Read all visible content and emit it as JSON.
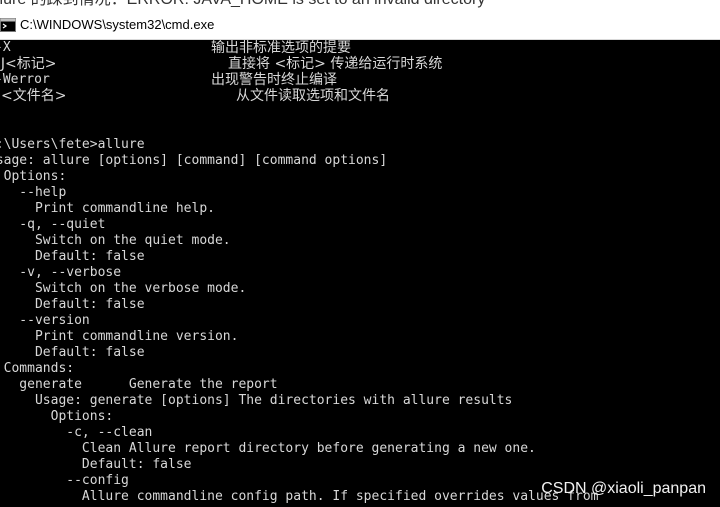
{
  "top_text": "llure 的踩到情况：ERROR: JAVA_HOME is set to an invalid directory",
  "window": {
    "title": "C:\\WINDOWS\\system32\\cmd.exe",
    "icon": "cmd-icon"
  },
  "console": {
    "options_help": [
      {
        "flag": "-X",
        "desc": "输出非标准选项的提要"
      },
      {
        "flag": "-J<标记>",
        "desc": "直接将 <标记> 传递给运行时系统"
      },
      {
        "flag": "-Werror",
        "desc": "出现警告时终止编译"
      },
      {
        "flag": "@<文件名>",
        "desc": "从文件读取选项和文件名"
      }
    ],
    "lines": [
      "C:\\Users\\fete>allure",
      "Usage: allure [options] [command] [command options]",
      "  Options:",
      "    --help",
      "      Print commandline help.",
      "    -q, --quiet",
      "      Switch on the quiet mode.",
      "      Default: false",
      "    -v, --verbose",
      "      Switch on the verbose mode.",
      "      Default: false",
      "    --version",
      "      Print commandline version.",
      "      Default: false",
      "  Commands:",
      "    generate      Generate the report",
      "      Usage: generate [options] The directories with allure results",
      "        Options:",
      "          -c, --clean",
      "            Clean Allure report directory before generating a new one.",
      "            Default: false",
      "          --config",
      "            Allure commandline config path. If specified overrides values from"
    ]
  },
  "watermark": "CSDN @xiaoli_panpan"
}
